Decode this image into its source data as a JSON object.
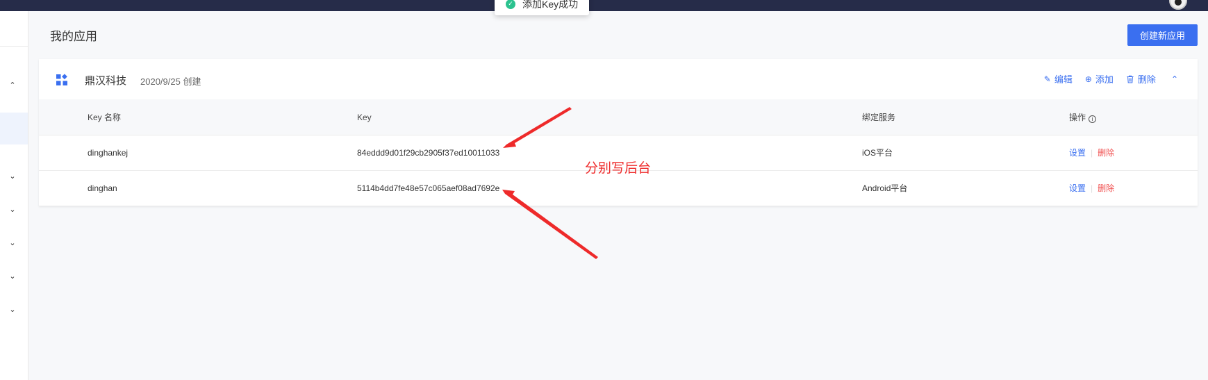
{
  "toast": {
    "message": "添加Key成功"
  },
  "page": {
    "title": "我的应用",
    "create_button": "创建新应用"
  },
  "app": {
    "name": "鼎汉科技",
    "created": "2020/9/25 创建",
    "actions": {
      "edit": "编辑",
      "add": "添加",
      "delete": "删除"
    }
  },
  "table": {
    "headers": [
      "Key 名称",
      "Key",
      "绑定服务",
      "操作"
    ],
    "rows": [
      {
        "name": "dinghankej",
        "key": "84eddd9d01f29cb2905f37ed10011033",
        "service": "iOS平台",
        "set": "设置",
        "del": "删除"
      },
      {
        "name": "dinghan",
        "key": "5114b4dd7fe48e57c065aef08ad7692e",
        "service": "Android平台",
        "set": "设置",
        "del": "删除"
      }
    ]
  },
  "annotation": {
    "text": "分别写后台",
    "color": "#ee2a2a"
  },
  "colors": {
    "primary": "#3a6ff0",
    "danger": "#f05050",
    "topbar": "#262c49",
    "success": "#2bc28f"
  },
  "icons": {
    "toast": "check-circle-icon",
    "app": "apps-icon",
    "edit": "edit-icon",
    "add": "plus-circle-icon",
    "delete": "trash-icon",
    "collapse": "chevron-up-icon",
    "info": "info-icon"
  }
}
